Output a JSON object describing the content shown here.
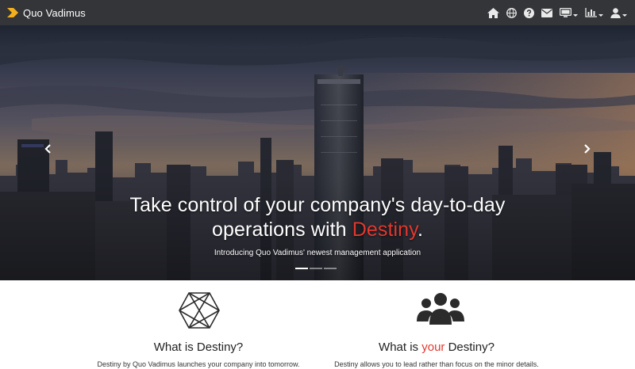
{
  "navbar": {
    "brand": "Quo Vadimus",
    "logo_icon": "chevron-logo-icon",
    "icons": [
      "home-icon",
      "globe-icon",
      "help-icon",
      "mail-icon",
      "monitor-icon",
      "chart-icon",
      "user-icon"
    ],
    "colors": {
      "background": "#333538",
      "icon": "#e9e9e9",
      "logo": "#f2b01e"
    }
  },
  "hero": {
    "headline_part1": "Take control of your company's day-to-day",
    "headline_part2": "operations with ",
    "headline_accent": "Destiny",
    "headline_end": ".",
    "subline": "Introducing Quo Vadimus' newest management application",
    "prev_icon": "chevron-left-icon",
    "next_icon": "chevron-right-icon",
    "slides": [
      {
        "active": true
      },
      {
        "active": false
      },
      {
        "active": false
      }
    ],
    "accent_color": "#e2382f"
  },
  "features": [
    {
      "icon": "hexagon-logo-icon",
      "title_before": "What is ",
      "title_accent": "",
      "title_after": "Destiny?",
      "description": "Destiny by Quo Vadimus launches your company into tomorrow."
    },
    {
      "icon": "users-group-icon",
      "title_before": "What is ",
      "title_accent": "your",
      "title_after": " Destiny?",
      "description": "Destiny allows you to lead rather than focus on the minor details."
    }
  ]
}
